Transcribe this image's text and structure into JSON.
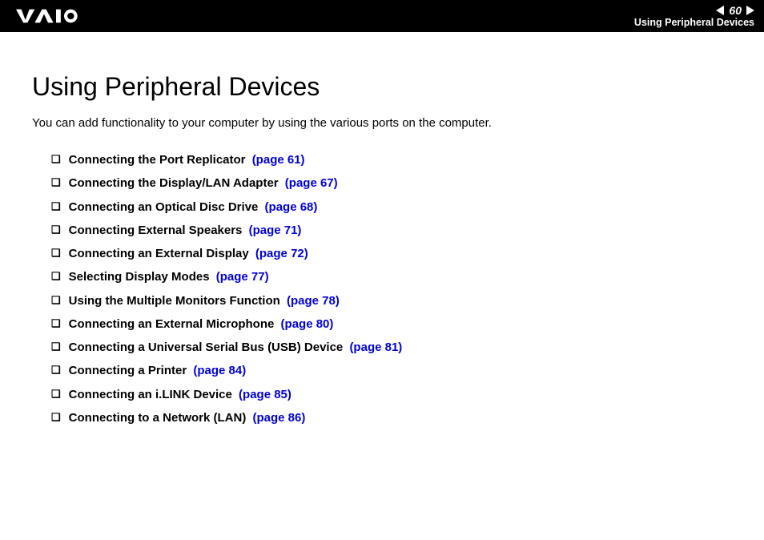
{
  "header": {
    "page_number": "60",
    "section_title": "Using Peripheral Devices"
  },
  "main": {
    "title": "Using Peripheral Devices",
    "intro": "You can add functionality to your computer by using the various ports on the computer.",
    "items": [
      {
        "label": "Connecting the Port Replicator",
        "ref": "(page 61)"
      },
      {
        "label": "Connecting the Display/LAN Adapter",
        "ref": "(page 67)"
      },
      {
        "label": "Connecting an Optical Disc Drive",
        "ref": "(page 68)"
      },
      {
        "label": "Connecting External Speakers",
        "ref": "(page 71)"
      },
      {
        "label": "Connecting an External Display",
        "ref": "(page 72)"
      },
      {
        "label": "Selecting Display Modes",
        "ref": "(page 77)"
      },
      {
        "label": "Using the Multiple Monitors Function",
        "ref": "(page 78)"
      },
      {
        "label": "Connecting an External Microphone",
        "ref": "(page 80)"
      },
      {
        "label": "Connecting a Universal Serial Bus (USB) Device",
        "ref": "(page 81)"
      },
      {
        "label": "Connecting a Printer",
        "ref": "(page 84)"
      },
      {
        "label": "Connecting an i.LINK Device",
        "ref": "(page 85)"
      },
      {
        "label": "Connecting to a Network (LAN)",
        "ref": "(page 86)"
      }
    ]
  }
}
